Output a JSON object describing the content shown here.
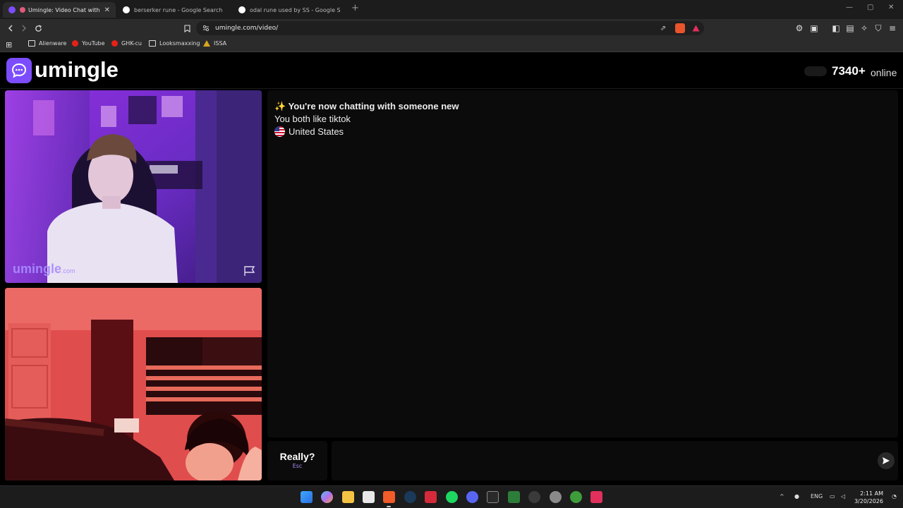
{
  "browser": {
    "tabs": [
      {
        "title": "Umingle: Video Chat with Stra",
        "active": true
      },
      {
        "title": "berserker rune - Google Search",
        "active": false
      },
      {
        "title": "odal rune used by SS - Google Search",
        "active": false
      }
    ],
    "url": "umingle.com/video/",
    "bookmarks": [
      {
        "label": "Alienware",
        "icon": "folder-icon"
      },
      {
        "label": "YouTube",
        "icon": "youtube-icon"
      },
      {
        "label": "GHK-cu",
        "icon": "youtube-icon"
      },
      {
        "label": "Looksmaxxing",
        "icon": "folder-icon"
      },
      {
        "label": "ISSA",
        "icon": "issa-icon"
      }
    ]
  },
  "site": {
    "brand": "umingle",
    "online_count": "7340+",
    "online_label": "online",
    "watermark_main": "umingle",
    "watermark_suffix": ".com",
    "accent_color": "#7c4dff"
  },
  "chat": {
    "title_emoji": "✨",
    "title": "You're now chatting with someone new",
    "interest": "You both like tiktok",
    "country": "United States"
  },
  "controls": {
    "really_label": "Really?",
    "esc_hint": "Esc",
    "message_placeholder": ""
  },
  "taskbar": {
    "language": "ENG",
    "time": "2:11 AM",
    "date": "3/20/2026"
  }
}
